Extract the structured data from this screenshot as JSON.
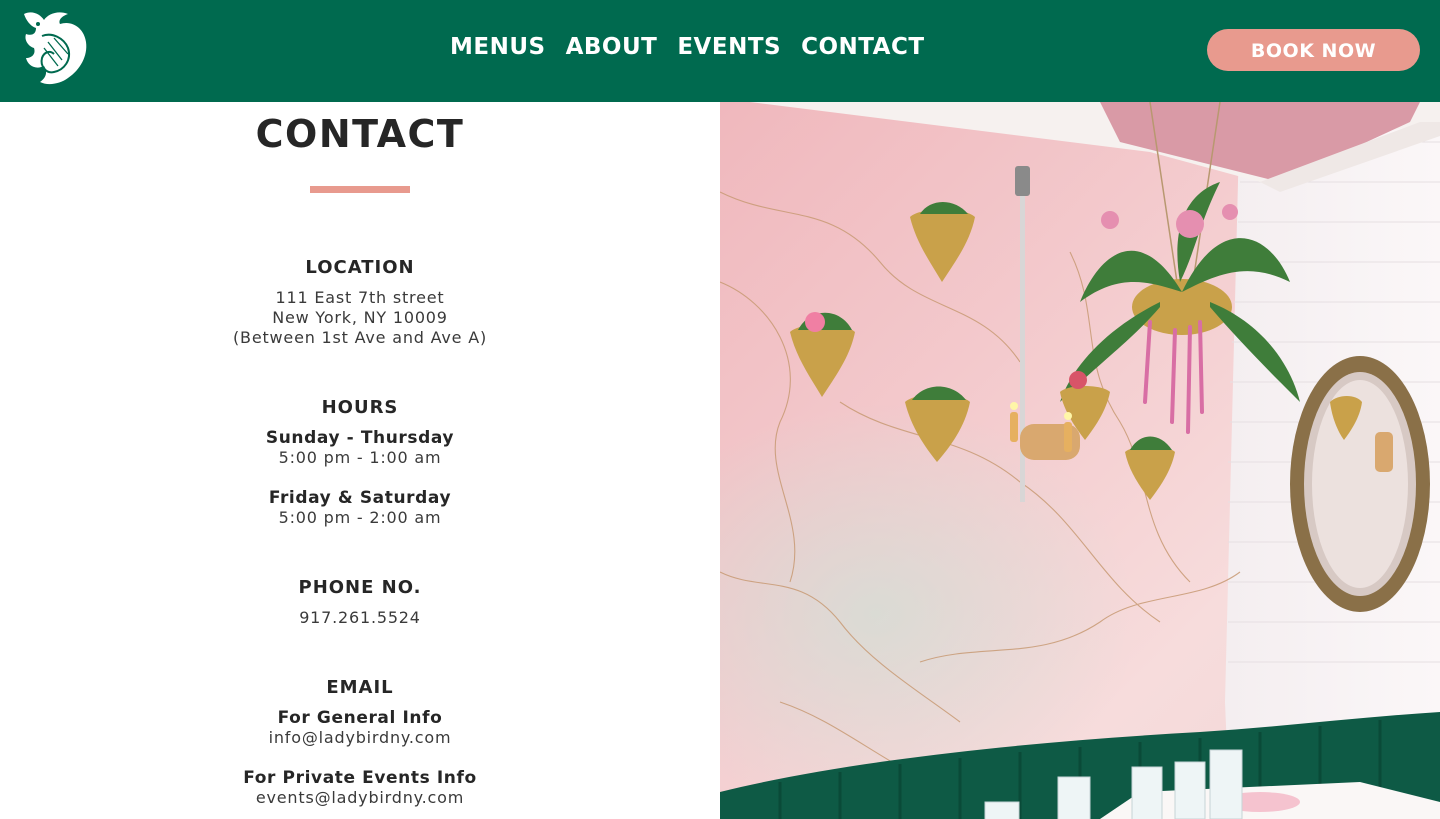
{
  "nav": {
    "items": [
      {
        "label": "MENUS"
      },
      {
        "label": "ABOUT"
      },
      {
        "label": "EVENTS"
      },
      {
        "label": "CONTACT"
      }
    ],
    "book_label": "BOOK NOW"
  },
  "page": {
    "title": "CONTACT"
  },
  "location": {
    "heading": "LOCATION",
    "line1": "111 East 7th street",
    "line2": "New York, NY 10009",
    "line3": "(Between 1st Ave and Ave A)"
  },
  "hours": {
    "heading": "HOURS",
    "groups": [
      {
        "days": "Sunday - Thursday",
        "time": "5:00 pm - 1:00 am"
      },
      {
        "days": "Friday & Saturday",
        "time": "5:00 pm - 2:00 am"
      }
    ]
  },
  "phone": {
    "heading": "PHONE NO.",
    "number": "917.261.5524"
  },
  "email": {
    "heading": "EMAIL",
    "entries": [
      {
        "label": "For General Info",
        "address": "info@ladybirdny.com"
      },
      {
        "label": "For Private Events Info",
        "address": "events@ladybirdny.com"
      }
    ]
  },
  "colors": {
    "header_green": "#006a4f",
    "accent_pink": "#e89a8e",
    "text_dark": "#262626"
  },
  "icons": {
    "logo": "ladybird-logo-icon"
  }
}
